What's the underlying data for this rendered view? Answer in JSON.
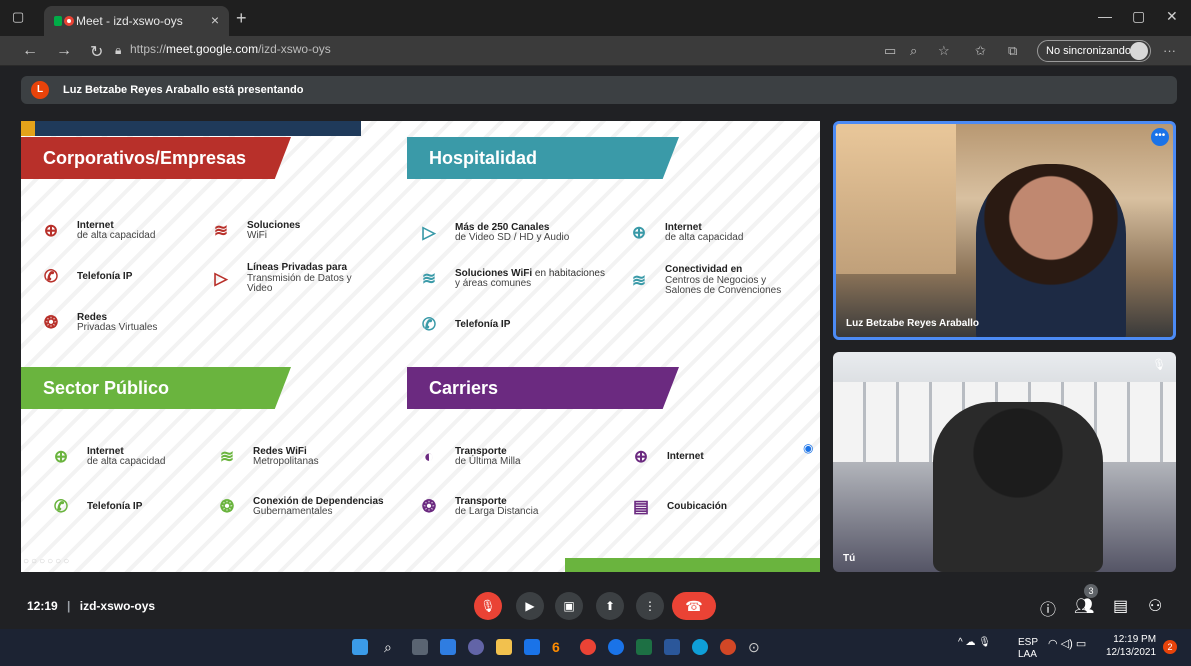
{
  "browser": {
    "tab_title": "Meet - izd-xswo-oys",
    "tab_close": "×",
    "new_tab": "+",
    "url_scheme": "https://",
    "url_host": "meet.google.com",
    "url_path": "/izd-xswo-oys",
    "sync_label": "No sincronizando",
    "more": "···"
  },
  "meet": {
    "presenting_initial": "L",
    "presenting_text": "Luz Betzabe Reyes Araballo está presentando",
    "time": "12:19",
    "meeting_code": "izd-xswo-oys",
    "participants_count": "3"
  },
  "slide": {
    "banners": {
      "corporativos": "Corporativos/Empresas",
      "hospitalidad": "Hospitalidad",
      "sector_publico": "Sector Público",
      "carriers": "Carriers"
    },
    "corporativos": [
      {
        "title": "Internet",
        "sub": "de alta capacidad"
      },
      {
        "title": "Soluciones",
        "sub": "WiFi"
      },
      {
        "title": "Telefonía IP",
        "sub": ""
      },
      {
        "title": "Líneas Privadas para",
        "sub": "Transmisión de Datos y Video"
      },
      {
        "title": "Redes",
        "sub": "Privadas Virtuales"
      }
    ],
    "hospitalidad": [
      {
        "title": "Más de 250 Canales",
        "sub": "de Video SD / HD y Audio"
      },
      {
        "title": "Internet",
        "sub": "de alta capacidad"
      },
      {
        "title": "Soluciones WiFi",
        "title_rest": " en habitaciones",
        "sub": "y áreas comunes"
      },
      {
        "title": "Conectividad en",
        "sub": "Centros de Negocios y Salones de Convenciones"
      },
      {
        "title": "Telefonía IP",
        "sub": ""
      }
    ],
    "sector_publico": [
      {
        "title": "Internet",
        "sub": "de alta capacidad"
      },
      {
        "title": "Redes WiFi",
        "sub": "Metropolitanas"
      },
      {
        "title": "Telefonía IP",
        "sub": ""
      },
      {
        "title": "Conexión de Dependencias",
        "sub": "Gubernamentales"
      }
    ],
    "carriers": [
      {
        "title": "Transporte",
        "sub": "de Última Milla"
      },
      {
        "title": "Internet",
        "sub": ""
      },
      {
        "title": "Transporte",
        "sub": "de Larga Distancia"
      },
      {
        "title": "Coubicación",
        "sub": ""
      }
    ]
  },
  "tiles": {
    "presenter_name": "Luz Betzabe Reyes Araballo",
    "self_name": "Tú"
  },
  "taskbar": {
    "lang": "ESP",
    "lang_sub": "LAA",
    "clock_time": "12:19 PM",
    "clock_date": "12/13/2021",
    "notifications": "2"
  },
  "colors": {
    "corporativos": "#b8302a",
    "hospitalidad": "#3a9aa8",
    "sector_publico": "#6ab43e",
    "carriers": "#6b2a80",
    "slide_topbar": "#1f3a5a",
    "slide_topbar_accent": "#e3a21a",
    "presenter_border": "#4c8bf5"
  }
}
